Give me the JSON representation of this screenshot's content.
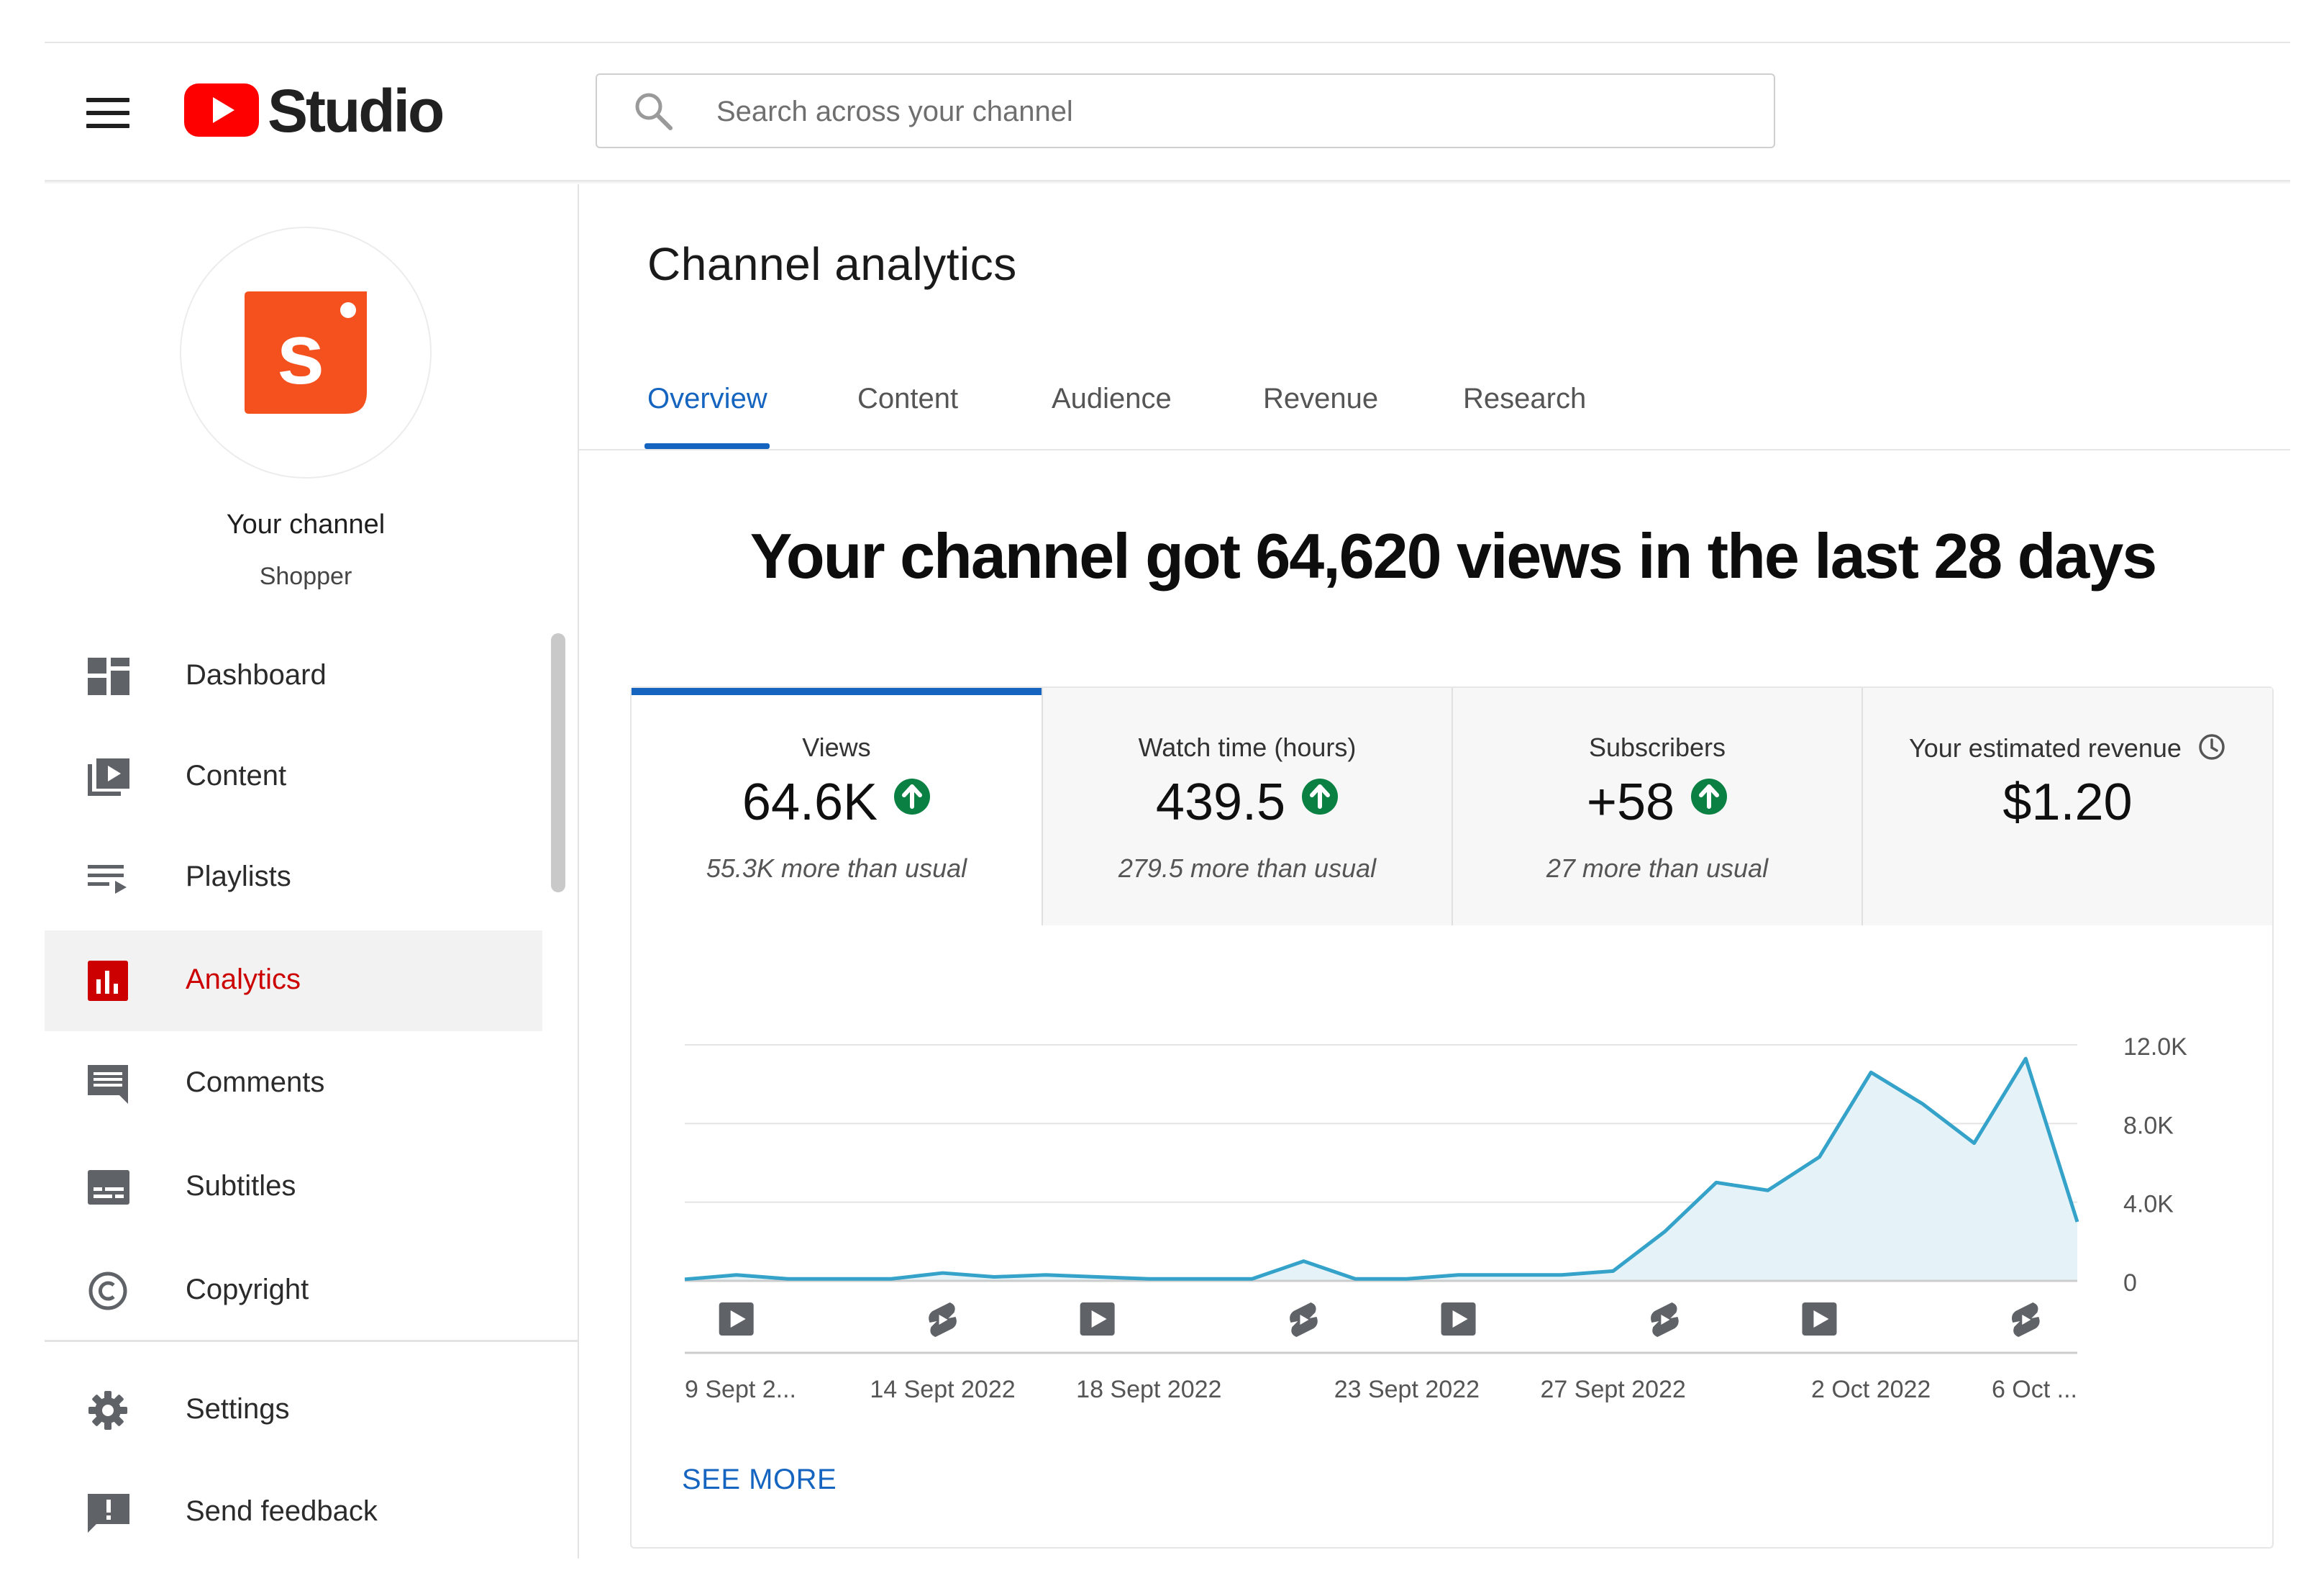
{
  "app": {
    "name": "Studio"
  },
  "search": {
    "placeholder": "Search across your channel"
  },
  "channel": {
    "name": "Your channel",
    "handle": "Shopper"
  },
  "sidebar": {
    "items": [
      {
        "label": "Dashboard",
        "icon": "dashboard-icon",
        "active": false
      },
      {
        "label": "Content",
        "icon": "content-icon",
        "active": false
      },
      {
        "label": "Playlists",
        "icon": "playlists-icon",
        "active": false
      },
      {
        "label": "Analytics",
        "icon": "analytics-icon",
        "active": true
      },
      {
        "label": "Comments",
        "icon": "comments-icon",
        "active": false
      },
      {
        "label": "Subtitles",
        "icon": "subtitles-icon",
        "active": false
      },
      {
        "label": "Copyright",
        "icon": "copyright-icon",
        "active": false
      }
    ],
    "bottom_items": [
      {
        "label": "Settings",
        "icon": "gear-icon"
      },
      {
        "label": "Send feedback",
        "icon": "feedback-icon"
      }
    ]
  },
  "main": {
    "title": "Channel analytics",
    "tabs": [
      {
        "label": "Overview",
        "active": true
      },
      {
        "label": "Content",
        "active": false
      },
      {
        "label": "Audience",
        "active": false
      },
      {
        "label": "Revenue",
        "active": false
      },
      {
        "label": "Research",
        "active": false
      }
    ],
    "headline": "Your channel got 64,620 views in the last 28 days",
    "metrics": [
      {
        "title": "Views",
        "value": "64.6K",
        "trend": "up",
        "subtitle": "55.3K more than usual",
        "active": true
      },
      {
        "title": "Watch time (hours)",
        "value": "439.5",
        "trend": "up",
        "subtitle": "279.5 more than usual",
        "active": false
      },
      {
        "title": "Subscribers",
        "value": "+58",
        "trend": "up",
        "subtitle": "27 more than usual",
        "active": false
      },
      {
        "title": "Your estimated revenue",
        "value": "$1.20",
        "trend": "none",
        "subtitle": "",
        "active": false
      }
    ],
    "see_more": "SEE MORE"
  },
  "colors": {
    "brand_red": "#ff0000",
    "accent_blue": "#1565c0",
    "active_nav_red": "#cc0000",
    "trend_green": "#0b8043",
    "line": "#35a3c9",
    "area": "#e5f3f8",
    "channel_logo": "#f4511e"
  },
  "chart_data": {
    "type": "area",
    "x": [
      "9 Sept 2022",
      "10 Sept 2022",
      "11 Sept 2022",
      "12 Sept 2022",
      "13 Sept 2022",
      "14 Sept 2022",
      "15 Sept 2022",
      "16 Sept 2022",
      "17 Sept 2022",
      "18 Sept 2022",
      "19 Sept 2022",
      "20 Sept 2022",
      "21 Sept 2022",
      "22 Sept 2022",
      "23 Sept 2022",
      "24 Sept 2022",
      "25 Sept 2022",
      "26 Sept 2022",
      "27 Sept 2022",
      "28 Sept 2022",
      "29 Sept 2022",
      "30 Sept 2022",
      "1 Oct 2022",
      "2 Oct 2022",
      "3 Oct 2022",
      "4 Oct 2022",
      "5 Oct 2022",
      "6 Oct 2022"
    ],
    "series": [
      {
        "values": [
          80,
          300,
          100,
          100,
          100,
          400,
          200,
          300,
          200,
          100,
          100,
          100,
          1000,
          100,
          100,
          300,
          300,
          300,
          500,
          2500,
          5000,
          4600,
          6300,
          10600,
          9000,
          7000,
          11300,
          3000
        ]
      }
    ],
    "y_ticks": [
      "12.0K",
      "8.0K",
      "4.0K",
      "0"
    ],
    "ylim": [
      0,
      12000
    ],
    "x_tick_labels": [
      {
        "index": 0,
        "label": "9 Sept 2..."
      },
      {
        "index": 5,
        "label": "14 Sept 2022"
      },
      {
        "index": 9,
        "label": "18 Sept 2022"
      },
      {
        "index": 14,
        "label": "23 Sept 2022"
      },
      {
        "index": 18,
        "label": "27 Sept 2022"
      },
      {
        "index": 23,
        "label": "2 Oct 2022"
      },
      {
        "index": 27,
        "label": "6 Oct ..."
      }
    ],
    "markers": [
      {
        "index": 1,
        "kind": "video"
      },
      {
        "index": 5,
        "kind": "short"
      },
      {
        "index": 8,
        "kind": "video"
      },
      {
        "index": 12,
        "kind": "short"
      },
      {
        "index": 15,
        "kind": "video"
      },
      {
        "index": 19,
        "kind": "short"
      },
      {
        "index": 22,
        "kind": "video"
      },
      {
        "index": 26,
        "kind": "short"
      }
    ],
    "grid": true,
    "y_axis_position": "right"
  }
}
